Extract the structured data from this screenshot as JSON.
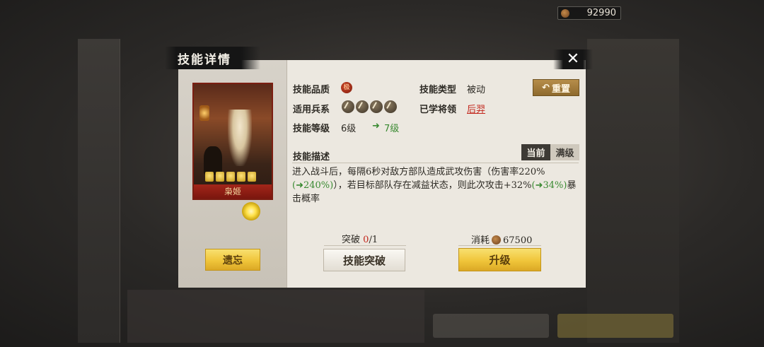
{
  "header": {
    "currency_value": "92990",
    "currency_icon": "copper-coin-icon"
  },
  "modal": {
    "title": "技能详情",
    "close_label": "✕",
    "reset_label": "重置",
    "card": {
      "name": "枭姬"
    },
    "info": {
      "quality_label": "技能品质",
      "quality_badge": "极",
      "type_label": "技能类型",
      "type_value": "被动",
      "troops_label": "适用兵系",
      "troop_icons": [
        "spear-icon",
        "cavalry-icon",
        "shield-icon",
        "bow-icon"
      ],
      "learned_label": "已学将领",
      "learned_value": "后羿",
      "level_label": "技能等级",
      "level_current": "6级",
      "level_next_arrow": "➜",
      "level_next": "7级"
    },
    "description": {
      "label": "技能描述",
      "tab_current": "当前",
      "tab_max": "满级",
      "seg1": "进入战斗后，每隔6秒对敌方部队造成武攻伤害（伤害率220%",
      "bonus1": "(➜240%)",
      "seg2": "），若目标部队存在减益状态，则此次攻击+32%",
      "bonus2": "(➜34%)",
      "seg3": "暴击概率"
    },
    "breakthrough": {
      "label": "突破",
      "current": "0",
      "total": "/1",
      "button": "技能突破"
    },
    "cost": {
      "label": "消耗",
      "value": "67500",
      "button": "升级"
    },
    "forget_button": "遗忘"
  }
}
